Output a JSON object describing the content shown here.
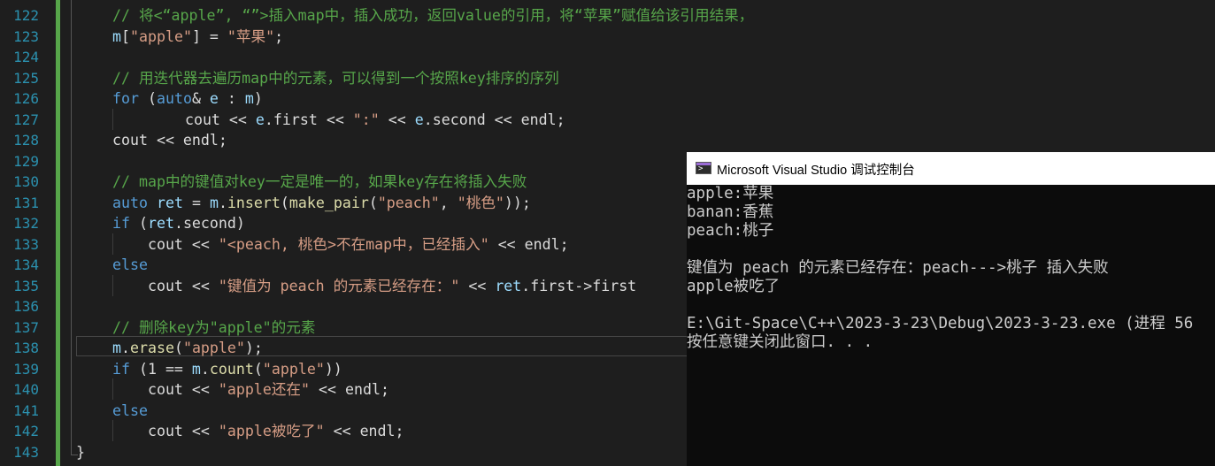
{
  "editor": {
    "line_numbers": [
      "122",
      "123",
      "124",
      "125",
      "126",
      "127",
      "128",
      "129",
      "130",
      "131",
      "132",
      "133",
      "134",
      "135",
      "136",
      "137",
      "138",
      "139",
      "140",
      "141",
      "142",
      "143"
    ],
    "lines": [
      [
        {
          "t": "// 将<“apple”, “”>插入map中，插入成功，返回value的引用，将“苹果”赋值给该引用结果，",
          "c": "c-comment"
        }
      ],
      [
        {
          "t": "m",
          "c": "c-var"
        },
        {
          "t": "[",
          "c": "c-plain"
        },
        {
          "t": "\"apple\"",
          "c": "c-str"
        },
        {
          "t": "] = ",
          "c": "c-plain"
        },
        {
          "t": "\"苹果\"",
          "c": "c-str"
        },
        {
          "t": ";",
          "c": "c-plain"
        }
      ],
      [],
      [
        {
          "t": "// 用迭代器去遍历map中的元素，可以得到一个按照key排序的序列",
          "c": "c-comment"
        }
      ],
      [
        {
          "t": "for",
          "c": "c-kw"
        },
        {
          "t": " (",
          "c": "c-plain"
        },
        {
          "t": "auto",
          "c": "c-kw"
        },
        {
          "t": "& ",
          "c": "c-plain"
        },
        {
          "t": "e",
          "c": "c-var"
        },
        {
          "t": " : ",
          "c": "c-plain"
        },
        {
          "t": "m",
          "c": "c-var"
        },
        {
          "t": ")",
          "c": "c-plain"
        }
      ],
      [
        {
          "t": "    cout << ",
          "c": "c-plain"
        },
        {
          "t": "e",
          "c": "c-var"
        },
        {
          "t": ".first << ",
          "c": "c-plain"
        },
        {
          "t": "\":\"",
          "c": "c-str"
        },
        {
          "t": " << ",
          "c": "c-plain"
        },
        {
          "t": "e",
          "c": "c-var"
        },
        {
          "t": ".second << endl;",
          "c": "c-plain"
        }
      ],
      [
        {
          "t": "cout << endl;",
          "c": "c-plain"
        }
      ],
      [],
      [
        {
          "t": "// map中的键值对key一定是唯一的，如果key存在将插入失败",
          "c": "c-comment"
        }
      ],
      [
        {
          "t": "auto",
          "c": "c-kw"
        },
        {
          "t": " ",
          "c": "c-plain"
        },
        {
          "t": "ret",
          "c": "c-var"
        },
        {
          "t": " = ",
          "c": "c-plain"
        },
        {
          "t": "m",
          "c": "c-var"
        },
        {
          "t": ".",
          "c": "c-plain"
        },
        {
          "t": "insert",
          "c": "c-fn"
        },
        {
          "t": "(",
          "c": "c-plain"
        },
        {
          "t": "make_pair",
          "c": "c-fn"
        },
        {
          "t": "(",
          "c": "c-plain"
        },
        {
          "t": "\"peach\"",
          "c": "c-str"
        },
        {
          "t": ", ",
          "c": "c-plain"
        },
        {
          "t": "\"桃色\"",
          "c": "c-str"
        },
        {
          "t": "));",
          "c": "c-plain"
        }
      ],
      [
        {
          "t": "if",
          "c": "c-kw"
        },
        {
          "t": " (",
          "c": "c-plain"
        },
        {
          "t": "ret",
          "c": "c-var"
        },
        {
          "t": ".second)",
          "c": "c-plain"
        }
      ],
      [
        {
          "t": "    cout << ",
          "c": "c-plain"
        },
        {
          "t": "\"<peach, 桃色>不在map中，已经插入\"",
          "c": "c-str"
        },
        {
          "t": " << endl;",
          "c": "c-plain"
        }
      ],
      [
        {
          "t": "else",
          "c": "c-kw"
        }
      ],
      [
        {
          "t": "    cout << ",
          "c": "c-plain"
        },
        {
          "t": "\"键值为 peach 的元素已经存在：\"",
          "c": "c-str"
        },
        {
          "t": " << ",
          "c": "c-plain"
        },
        {
          "t": "ret",
          "c": "c-var"
        },
        {
          "t": ".first->first",
          "c": "c-plain"
        }
      ],
      [],
      [
        {
          "t": "// 删除key为\"apple\"的元素",
          "c": "c-comment"
        }
      ],
      [
        {
          "t": "m",
          "c": "c-var"
        },
        {
          "t": ".",
          "c": "c-plain"
        },
        {
          "t": "erase",
          "c": "c-fn"
        },
        {
          "t": "(",
          "c": "c-plain"
        },
        {
          "t": "\"apple\"",
          "c": "c-str"
        },
        {
          "t": ");",
          "c": "c-plain"
        }
      ],
      [
        {
          "t": "if",
          "c": "c-kw"
        },
        {
          "t": " (1 == ",
          "c": "c-plain"
        },
        {
          "t": "m",
          "c": "c-var"
        },
        {
          "t": ".",
          "c": "c-plain"
        },
        {
          "t": "count",
          "c": "c-fn"
        },
        {
          "t": "(",
          "c": "c-plain"
        },
        {
          "t": "\"apple\"",
          "c": "c-str"
        },
        {
          "t": "))",
          "c": "c-plain"
        }
      ],
      [
        {
          "t": "    cout << ",
          "c": "c-plain"
        },
        {
          "t": "\"apple还在\"",
          "c": "c-str"
        },
        {
          "t": " << endl;",
          "c": "c-plain"
        }
      ],
      [
        {
          "t": "else",
          "c": "c-kw"
        }
      ],
      [
        {
          "t": "    cout << ",
          "c": "c-plain"
        },
        {
          "t": "\"apple被吃了\"",
          "c": "c-str"
        },
        {
          "t": " << endl;",
          "c": "c-plain"
        }
      ],
      [
        {
          "t": "}",
          "c": "c-plain"
        }
      ]
    ]
  },
  "console": {
    "title": "Microsoft Visual Studio 调试控制台",
    "lines": [
      "apple:苹果",
      "banan:香蕉",
      "peach:桃子",
      "",
      "键值为 peach 的元素已经存在：peach--->桃子 插入失败",
      "apple被吃了",
      "",
      "E:\\Git-Space\\C++\\2023-3-23\\Debug\\2023-3-23.exe (进程 56",
      "按任意键关闭此窗口. . ."
    ]
  }
}
